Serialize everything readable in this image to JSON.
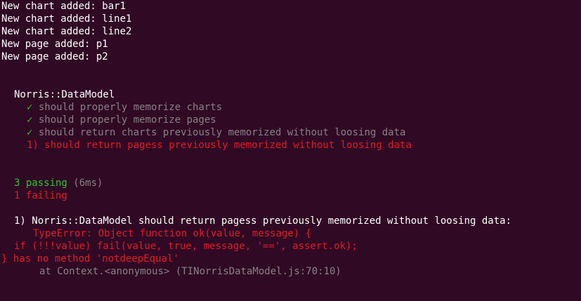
{
  "log": [
    "New chart added: bar1",
    "New chart added: line1",
    "New chart added: line2",
    "New page added: p1",
    "New page added: p2"
  ],
  "suite": {
    "title": "Norris::DataModel",
    "check_glyph": "✓",
    "passed": [
      "should properly memorize charts",
      "should properly memorize pages",
      "should return charts previously memorized without loosing data"
    ],
    "failed": [
      "1) should return pagess previously memorized without loosing data"
    ]
  },
  "summary": {
    "passing": "3 passing",
    "duration": "(6ms)",
    "failing": "1 failing"
  },
  "failure": {
    "title": "1) Norris::DataModel should return pagess previously memorized without loosing data:",
    "lines": [
      "TypeError: Object function ok(value, message) {",
      "if (!!!value) fail(value, true, message, '==', assert.ok);",
      "} has no method 'notdeepEqual'"
    ],
    "stack": "at Context.<anonymous> (TINorrisDataModel.js:70:10)"
  },
  "colors": {
    "background": "#300a24",
    "text": "#ffffff",
    "muted": "#8a7f86",
    "error": "#e01b24",
    "success": "#2bc42b"
  }
}
